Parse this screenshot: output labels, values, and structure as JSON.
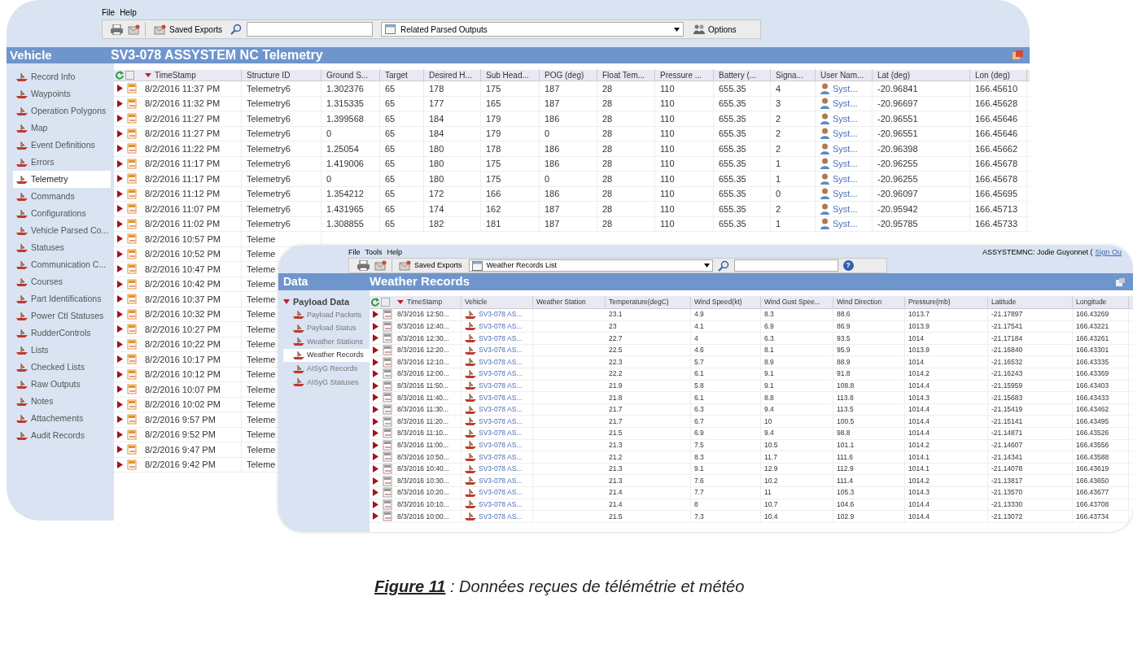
{
  "back_window": {
    "menu": [
      {
        "label": "File"
      },
      {
        "label": "Help"
      }
    ],
    "toolbar": {
      "saved_exports": "Saved Exports",
      "dropdown": "Related Parsed Outputs",
      "options": "Options"
    },
    "sidebar_title": "Vehicle",
    "title": "SV3-078 ASSYSTEM NC Telemetry",
    "sidebar": [
      {
        "label": "Record Info",
        "selected": false
      },
      {
        "label": "Waypoints",
        "selected": false
      },
      {
        "label": "Operation Polygons",
        "selected": false
      },
      {
        "label": "Map",
        "selected": false
      },
      {
        "label": "Event Definitions",
        "selected": false
      },
      {
        "label": "Errors",
        "selected": false
      },
      {
        "label": "Telemetry",
        "selected": true
      },
      {
        "label": "Commands",
        "selected": false
      },
      {
        "label": "Configurations",
        "selected": false
      },
      {
        "label": "Vehicle Parsed Co...",
        "selected": false
      },
      {
        "label": "Statuses",
        "selected": false
      },
      {
        "label": "Communication C...",
        "selected": false
      },
      {
        "label": "Courses",
        "selected": false
      },
      {
        "label": "Part Identifications",
        "selected": false
      },
      {
        "label": "Power Ctl Statuses",
        "selected": false
      },
      {
        "label": "RudderControls",
        "selected": false
      },
      {
        "label": "Lists",
        "selected": false
      },
      {
        "label": "Checked Lists",
        "selected": false
      },
      {
        "label": "Raw Outputs",
        "selected": false
      },
      {
        "label": "Notes",
        "selected": false
      },
      {
        "label": "Attachements",
        "selected": false
      },
      {
        "label": "Audit Records",
        "selected": false
      }
    ],
    "table": {
      "select_all": {
        "checked": false
      },
      "columns": [
        {
          "label": "TimeStamp",
          "kind": "text"
        },
        {
          "label": "Structure ID",
          "kind": "text"
        },
        {
          "label": "Ground S...",
          "kind": "text"
        },
        {
          "label": "Target",
          "kind": "text"
        },
        {
          "label": "Desired H...",
          "kind": "text"
        },
        {
          "label": "Sub Head...",
          "kind": "text"
        },
        {
          "label": "POG (deg)",
          "kind": "text"
        },
        {
          "label": "Float Tem...",
          "kind": "text"
        },
        {
          "label": "Pressure ...",
          "kind": "text"
        },
        {
          "label": "Battery (...",
          "kind": "text"
        },
        {
          "label": "Signa...",
          "kind": "text"
        },
        {
          "label": "User Nam...",
          "kind": "user"
        },
        {
          "label": "Lat (deg)",
          "kind": "text"
        },
        {
          "label": "Lon (deg)",
          "kind": "text"
        }
      ],
      "rows": [
        {
          "cells": [
            "8/2/2016 11:37 PM",
            "Telemetry6",
            "1.302376",
            "65",
            "178",
            "175",
            "187",
            "28",
            "110",
            "655.35",
            "4",
            "Syst...",
            "-20.96841",
            "166.45610"
          ]
        },
        {
          "cells": [
            "8/2/2016 11:32 PM",
            "Telemetry6",
            "1.315335",
            "65",
            "177",
            "165",
            "187",
            "28",
            "110",
            "655.35",
            "3",
            "Syst...",
            "-20.96697",
            "166.45628"
          ]
        },
        {
          "cells": [
            "8/2/2016 11:27 PM",
            "Telemetry6",
            "1.399568",
            "65",
            "184",
            "179",
            "186",
            "28",
            "110",
            "655.35",
            "2",
            "Syst...",
            "-20.96551",
            "166.45646"
          ]
        },
        {
          "cells": [
            "8/2/2016 11:27 PM",
            "Telemetry6",
            "0",
            "65",
            "184",
            "179",
            "0",
            "28",
            "110",
            "655.35",
            "2",
            "Syst...",
            "-20.96551",
            "166.45646"
          ]
        },
        {
          "cells": [
            "8/2/2016 11:22 PM",
            "Telemetry6",
            "1.25054",
            "65",
            "180",
            "178",
            "186",
            "28",
            "110",
            "655.35",
            "2",
            "Syst...",
            "-20.96398",
            "166.45662"
          ]
        },
        {
          "cells": [
            "8/2/2016 11:17 PM",
            "Telemetry6",
            "1.419006",
            "65",
            "180",
            "175",
            "186",
            "28",
            "110",
            "655.35",
            "1",
            "Syst...",
            "-20.96255",
            "166.45678"
          ]
        },
        {
          "cells": [
            "8/2/2016 11:17 PM",
            "Telemetry6",
            "0",
            "65",
            "180",
            "175",
            "0",
            "28",
            "110",
            "655.35",
            "1",
            "Syst...",
            "-20.96255",
            "166.45678"
          ]
        },
        {
          "cells": [
            "8/2/2016 11:12 PM",
            "Telemetry6",
            "1.354212",
            "65",
            "172",
            "166",
            "186",
            "28",
            "110",
            "655.35",
            "0",
            "Syst...",
            "-20.96097",
            "166.45695"
          ]
        },
        {
          "cells": [
            "8/2/2016 11:07 PM",
            "Telemetry6",
            "1.431965",
            "65",
            "174",
            "162",
            "187",
            "28",
            "110",
            "655.35",
            "2",
            "Syst...",
            "-20.95942",
            "166.45713"
          ]
        },
        {
          "cells": [
            "8/2/2016 11:02 PM",
            "Telemetry6",
            "1.308855",
            "65",
            "182",
            "181",
            "187",
            "28",
            "110",
            "655.35",
            "1",
            "Syst...",
            "-20.95785",
            "166.45733"
          ]
        },
        {
          "cells": [
            "8/2/2016 10:57 PM",
            "Teleme"
          ]
        },
        {
          "cells": [
            "8/2/2016 10:52 PM",
            "Teleme"
          ]
        },
        {
          "cells": [
            "8/2/2016 10:47 PM",
            "Teleme"
          ]
        },
        {
          "cells": [
            "8/2/2016 10:42 PM",
            "Teleme"
          ]
        },
        {
          "cells": [
            "8/2/2016 10:37 PM",
            "Teleme"
          ]
        },
        {
          "cells": [
            "8/2/2016 10:32 PM",
            "Teleme"
          ]
        },
        {
          "cells": [
            "8/2/2016 10:27 PM",
            "Teleme"
          ]
        },
        {
          "cells": [
            "8/2/2016 10:22 PM",
            "Teleme"
          ]
        },
        {
          "cells": [
            "8/2/2016 10:17 PM",
            "Teleme"
          ]
        },
        {
          "cells": [
            "8/2/2016 10:12 PM",
            "Teleme"
          ]
        },
        {
          "cells": [
            "8/2/2016 10:07 PM",
            "Teleme"
          ]
        },
        {
          "cells": [
            "8/2/2016 10:02 PM",
            "Teleme"
          ]
        },
        {
          "cells": [
            "8/2/2016 9:57 PM",
            "Teleme"
          ]
        },
        {
          "cells": [
            "8/2/2016 9:52 PM",
            "Teleme"
          ]
        },
        {
          "cells": [
            "8/2/2016 9:47 PM",
            "Teleme"
          ]
        },
        {
          "cells": [
            "8/2/2016 9:42 PM",
            "Teleme"
          ]
        }
      ]
    }
  },
  "front_window": {
    "menu": [
      {
        "label": "File"
      },
      {
        "label": "Tools"
      },
      {
        "label": "Help"
      }
    ],
    "user": "ASSYSTEMNC: Jodie Guyonnet (",
    "sign_out": "Sign Ou",
    "toolbar": {
      "saved_exports": "Saved Exports",
      "dropdown": "Weather Records List",
      "help": "?"
    },
    "sidebar_title": "Data",
    "title": "Weather Records",
    "tree": [
      {
        "label": "Payload Data",
        "expanded": true,
        "children": [
          {
            "label": "Payload Packets",
            "selected": false
          },
          {
            "label": "Payload Status",
            "selected": false
          },
          {
            "label": "Weather Stations",
            "selected": false
          },
          {
            "label": "Weather Records",
            "selected": true
          },
          {
            "label": "AISyG Records",
            "selected": false
          },
          {
            "label": "AISyG Statuses",
            "selected": false
          }
        ]
      }
    ],
    "table": {
      "select_all": {
        "checked": false
      },
      "columns": [
        {
          "label": "TimeStamp",
          "kind": "text"
        },
        {
          "label": "Vehicle",
          "kind": "link"
        },
        {
          "label": "Weather Station",
          "kind": "text"
        },
        {
          "label": "Temperature(degC)",
          "kind": "text"
        },
        {
          "label": "Wind Speed(kt)",
          "kind": "text"
        },
        {
          "label": "Wind Gust Spee...",
          "kind": "text"
        },
        {
          "label": "Wind Direction",
          "kind": "text"
        },
        {
          "label": "Pressure(mb)",
          "kind": "text"
        },
        {
          "label": "Latitude",
          "kind": "text"
        },
        {
          "label": "Longitude",
          "kind": "text"
        }
      ],
      "rows": [
        {
          "cells": [
            "8/3/2016 12:50...",
            "SV3-078 AS...",
            "",
            "23.1",
            "4.9",
            "8.3",
            "88.6",
            "1013.7",
            "-21.17897",
            "166.43269"
          ]
        },
        {
          "cells": [
            "8/3/2016 12:40...",
            "SV3-078 AS...",
            "",
            "23",
            "4.1",
            "6.9",
            "86.9",
            "1013.9",
            "-21.17541",
            "166.43221"
          ]
        },
        {
          "cells": [
            "8/3/2016 12:30...",
            "SV3-078 AS...",
            "",
            "22.7",
            "4",
            "6.3",
            "93.5",
            "1014",
            "-21.17184",
            "166.43261"
          ]
        },
        {
          "cells": [
            "8/3/2016 12:20...",
            "SV3-078 AS...",
            "",
            "22.5",
            "4.6",
            "8.1",
            "95.9",
            "1013.9",
            "-21.16840",
            "166.43301"
          ]
        },
        {
          "cells": [
            "8/3/2016 12:10...",
            "SV3-078 AS...",
            "",
            "22.3",
            "5.7",
            "8.9",
            "88.9",
            "1014",
            "-21.16532",
            "166.43335"
          ]
        },
        {
          "cells": [
            "8/3/2016 12:00...",
            "SV3-078 AS...",
            "",
            "22.2",
            "6.1",
            "9.1",
            "91.8",
            "1014.2",
            "-21.16243",
            "166.43369"
          ]
        },
        {
          "cells": [
            "8/3/2016 11:50...",
            "SV3-078 AS...",
            "",
            "21.9",
            "5.8",
            "9.1",
            "108.8",
            "1014.4",
            "-21.15959",
            "166.43403"
          ]
        },
        {
          "cells": [
            "8/3/2016 11:40...",
            "SV3-078 AS...",
            "",
            "21.8",
            "6.1",
            "8.8",
            "113.8",
            "1014.3",
            "-21.15683",
            "166.43433"
          ]
        },
        {
          "cells": [
            "8/3/2016 11:30...",
            "SV3-078 AS...",
            "",
            "21.7",
            "6.3",
            "9.4",
            "113.5",
            "1014.4",
            "-21.15419",
            "166.43462"
          ]
        },
        {
          "cells": [
            "8/3/2016 11:20...",
            "SV3-078 AS...",
            "",
            "21.7",
            "6.7",
            "10",
            "100.5",
            "1014.4",
            "-21.15141",
            "166.43495"
          ]
        },
        {
          "cells": [
            "8/3/2016 11:10...",
            "SV3-078 AS...",
            "",
            "21.5",
            "6.9",
            "9.4",
            "98.8",
            "1014.4",
            "-21.14871",
            "166.43526"
          ]
        },
        {
          "cells": [
            "8/3/2016 11:00...",
            "SV3-078 AS...",
            "",
            "21.3",
            "7.5",
            "10.5",
            "101.1",
            "1014.2",
            "-21.14607",
            "166.43556"
          ]
        },
        {
          "cells": [
            "8/3/2016 10:50...",
            "SV3-078 AS...",
            "",
            "21.2",
            "8.3",
            "11.7",
            "111.6",
            "1014.1",
            "-21.14341",
            "166.43588"
          ]
        },
        {
          "cells": [
            "8/3/2016 10:40...",
            "SV3-078 AS...",
            "",
            "21.3",
            "9.1",
            "12.9",
            "112.9",
            "1014.1",
            "-21.14078",
            "166.43619"
          ]
        },
        {
          "cells": [
            "8/3/2016 10:30...",
            "SV3-078 AS...",
            "",
            "21.3",
            "7.6",
            "10.2",
            "111.4",
            "1014.2",
            "-21.13817",
            "166.43650"
          ]
        },
        {
          "cells": [
            "8/3/2016 10:20...",
            "SV3-078 AS...",
            "",
            "21.4",
            "7.7",
            "11",
            "105.3",
            "1014.3",
            "-21.13570",
            "166.43677"
          ]
        },
        {
          "cells": [
            "8/3/2016 10:10...",
            "SV3-078 AS...",
            "",
            "21.4",
            "8",
            "10.7",
            "104.6",
            "1014.4",
            "-21.13330",
            "166.43708"
          ]
        },
        {
          "cells": [
            "8/3/2016 10:00...",
            "SV3-078 AS...",
            "",
            "21.5",
            "7.3",
            "10.4",
            "102.9",
            "1014.4",
            "-21.13072",
            "166.43734"
          ]
        }
      ]
    }
  },
  "caption": {
    "label": "Figure 11",
    "text": " : Données reçues de télémétrie et météo"
  }
}
